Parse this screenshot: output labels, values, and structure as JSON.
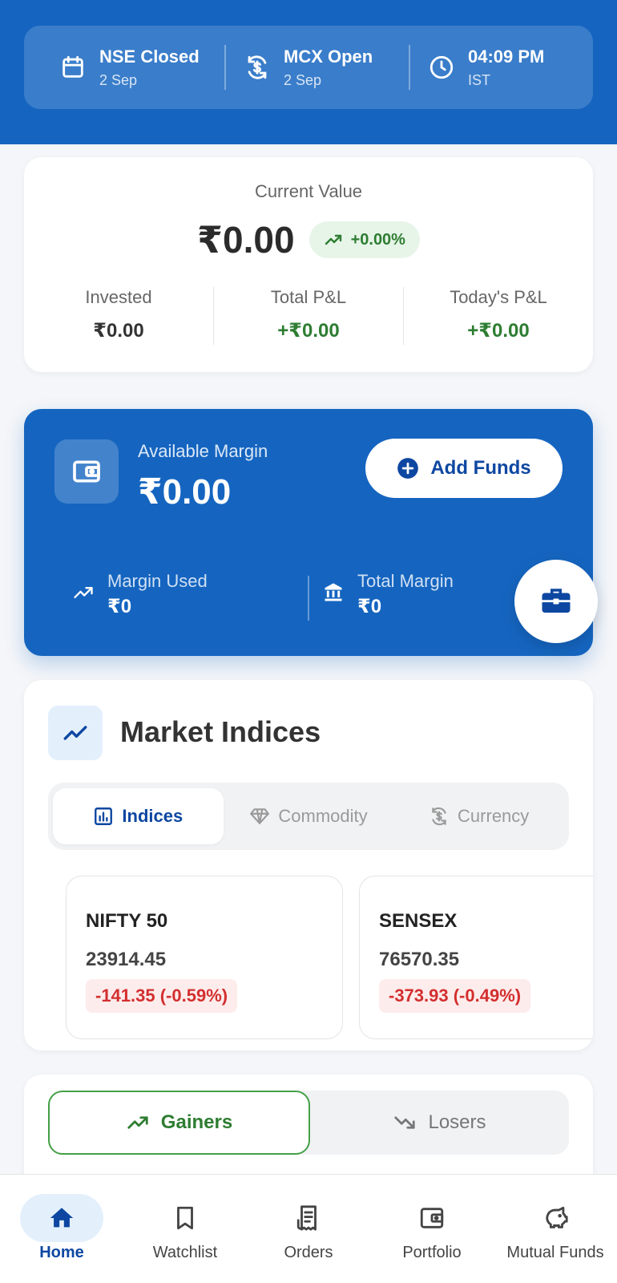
{
  "status_bar": {
    "items": [
      {
        "title": "NSE Closed",
        "subtitle": "2 Sep",
        "icon": "calendar-icon"
      },
      {
        "title": "MCX Open",
        "subtitle": "2 Sep",
        "icon": "currency-exchange-icon"
      },
      {
        "title": "04:09 PM",
        "subtitle": "IST",
        "icon": "clock-icon"
      }
    ]
  },
  "portfolio": {
    "current_value_label": "Current Value",
    "current_value": "₹0.00",
    "change": "+0.00%",
    "stats": [
      {
        "label": "Invested",
        "value": "₹0.00"
      },
      {
        "label": "Total P&L",
        "value": "+₹0.00"
      },
      {
        "label": "Today's P&L",
        "value": "+₹0.00"
      }
    ]
  },
  "margin": {
    "available_label": "Available Margin",
    "available_value": "₹0.00",
    "add_funds_label": "Add Funds",
    "used_label": "Margin Used",
    "used_value": "₹0",
    "total_label": "Total Margin",
    "total_value": "₹0"
  },
  "market_indices": {
    "title": "Market Indices",
    "tabs": [
      {
        "label": "Indices",
        "icon": "bar-chart-icon",
        "active": true
      },
      {
        "label": "Commodity",
        "icon": "diamond-icon",
        "active": false
      },
      {
        "label": "Currency",
        "icon": "currency-exchange-icon",
        "active": false
      }
    ],
    "cards": [
      {
        "name": "NIFTY 50",
        "price": "23914.45",
        "change": "-141.35 (-0.59%)"
      },
      {
        "name": "SENSEX",
        "price": "76570.35",
        "change": "-373.93 (-0.49%)"
      }
    ]
  },
  "movers": {
    "gainers_label": "Gainers",
    "losers_label": "Losers"
  },
  "bottom_nav": {
    "items": [
      {
        "label": "Home",
        "icon": "home-icon",
        "active": true
      },
      {
        "label": "Watchlist",
        "icon": "bookmark-icon",
        "active": false
      },
      {
        "label": "Orders",
        "icon": "receipt-icon",
        "active": false
      },
      {
        "label": "Portfolio",
        "icon": "wallet-icon",
        "active": false
      },
      {
        "label": "Mutual Funds",
        "icon": "piggy-bank-icon",
        "active": false
      }
    ]
  },
  "colors": {
    "primary": "#1565c0",
    "positive": "#2e7d32",
    "negative": "#d32f2f"
  }
}
